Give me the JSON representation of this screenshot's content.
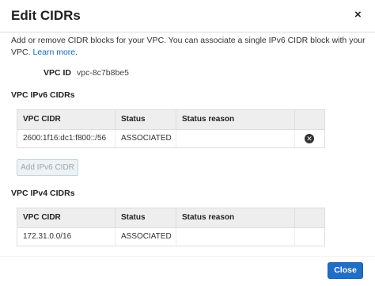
{
  "dialog": {
    "title": "Edit CIDRs",
    "close_glyph": "×",
    "description_text": "Add or remove CIDR blocks for your VPC. You can associate a single IPv6 CIDR block with your VPC. ",
    "learn_more_label": "Learn more",
    "description_suffix": "."
  },
  "vpc": {
    "label": "VPC ID",
    "value": "vpc-8c7b8be5"
  },
  "ipv6": {
    "section_title": "VPC IPv6 CIDRs",
    "columns": [
      "VPC CIDR",
      "Status",
      "Status reason"
    ],
    "rows": [
      {
        "cidr": "2600:1f16:dc1:f800::/56",
        "status": "ASSOCIATED",
        "reason": "",
        "remove_icon": "remove-circle-icon"
      }
    ],
    "add_button_label": "Add IPv6 CIDR"
  },
  "ipv4": {
    "section_title": "VPC IPv4 CIDRs",
    "columns": [
      "VPC CIDR",
      "Status",
      "Status reason"
    ],
    "rows": [
      {
        "cidr": "172.31.0.0/16",
        "status": "ASSOCIATED",
        "reason": ""
      }
    ]
  },
  "footer": {
    "close_button_label": "Close"
  },
  "colors": {
    "primary": "#1f6fc9",
    "link": "#1166bb",
    "header_bg": "#eeeeee"
  }
}
